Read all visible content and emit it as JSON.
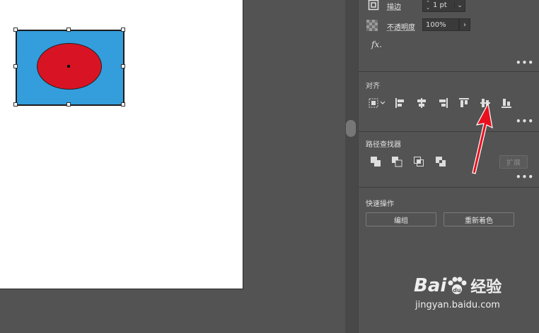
{
  "appearance": {
    "stroke_label": "描边",
    "stroke_value": "1 pt",
    "opacity_label": "不透明度",
    "opacity_value": "100%",
    "fx_label": "fx."
  },
  "align": {
    "title": "对齐",
    "icons": [
      "align-to-selection-icon",
      "horizontal-align-left-icon",
      "horizontal-align-center-icon",
      "horizontal-align-right-icon",
      "vertical-align-top-icon",
      "vertical-align-center-icon",
      "vertical-align-bottom-icon"
    ]
  },
  "pathfinder": {
    "title": "路径查找器",
    "expand_label": "扩展",
    "icons": [
      "unite-icon",
      "minus-front-icon",
      "intersect-icon",
      "exclude-icon"
    ]
  },
  "quick_actions": {
    "title": "快速操作",
    "group_label": "编组",
    "recolor_label": "重新着色"
  },
  "more_label": "•••",
  "watermark": {
    "brand_left": "Bai",
    "brand_right": "经验",
    "brand_du": "du",
    "url": "jingyan.baidu.com"
  },
  "colors": {
    "rect_fill": "#349ddc",
    "ellipse_fill": "#d81424",
    "arrow": "#e8101e",
    "panel_bg": "#535353"
  }
}
